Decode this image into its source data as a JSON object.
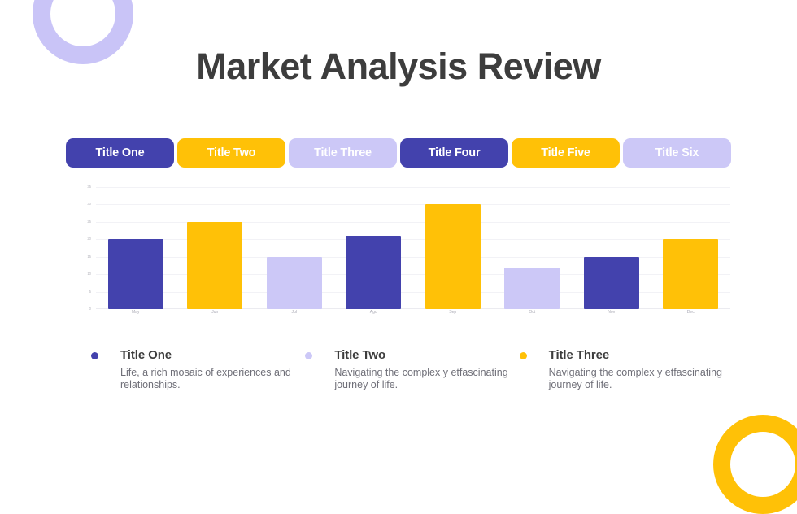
{
  "slide": {
    "title": "Market Analysis Review",
    "background": "#ffffff"
  },
  "palette": {
    "indigo": "#4342ad",
    "yellow": "#ffc107",
    "lavender": "#ccc8f7",
    "title_gray": "#3d3d3d",
    "body_gray": "#6f6f78",
    "tick_gray": "#a9a9b4"
  },
  "decorations": [
    {
      "name": "ring-top-left",
      "color": "#c9c4f7"
    },
    {
      "name": "ring-bottom-right",
      "color": "#ffc107"
    }
  ],
  "tabs": [
    {
      "label": "Title One",
      "bg": "#4342ad",
      "fg": "#ffffff"
    },
    {
      "label": "Title Two",
      "bg": "#ffc107",
      "fg": "#ffffff"
    },
    {
      "label": "Title Three",
      "bg": "#ccc8f7",
      "fg": "#ffffff"
    },
    {
      "label": "Title Four",
      "bg": "#4342ad",
      "fg": "#ffffff"
    },
    {
      "label": "Title Five",
      "bg": "#ffc107",
      "fg": "#ffffff"
    },
    {
      "label": "Title Six",
      "bg": "#ccc8f7",
      "fg": "#ffffff"
    }
  ],
  "chart_data": {
    "type": "bar",
    "title": "",
    "xlabel": "",
    "ylabel": "",
    "categories": [
      "May",
      "Jun",
      "Jul",
      "Ago",
      "Sep",
      "Oct",
      "Nov",
      "Dec"
    ],
    "values": [
      20,
      25,
      15,
      21,
      30,
      12,
      15,
      20
    ],
    "colors": [
      "#4342ad",
      "#ffc107",
      "#ccc8f7",
      "#4342ad",
      "#ffc107",
      "#ccc8f7",
      "#4342ad",
      "#ffc107"
    ],
    "ylim": [
      0,
      35
    ],
    "yticks": [
      0,
      5,
      10,
      15,
      20,
      25,
      30,
      35
    ],
    "ytick_labels": [
      "0",
      "5",
      "10",
      "15",
      "20",
      "25",
      "30",
      "35"
    ],
    "grid": true,
    "legend_position": "below"
  },
  "legend": [
    {
      "title": "Title One",
      "desc": "Life, a rich mosaic of experiences and relationships.",
      "color": "#4342ad"
    },
    {
      "title": "Title Two",
      "desc": "Navigating the complex y etfascinating journey of life.",
      "color": "#ccc8f7"
    },
    {
      "title": "Title Three",
      "desc": "Navigating the complex y etfascinating journey of life.",
      "color": "#ffc107"
    }
  ]
}
